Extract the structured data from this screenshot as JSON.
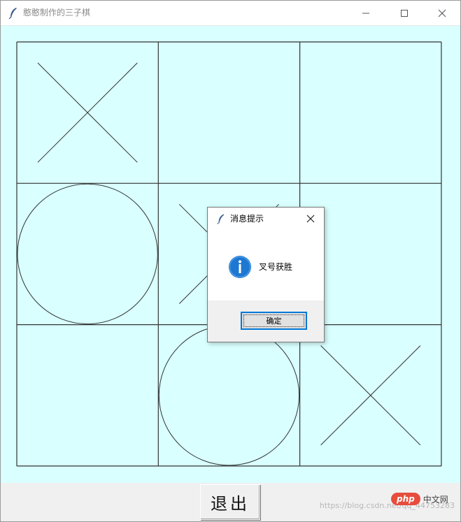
{
  "window": {
    "title": "憨憨制作的三子棋",
    "icon": "feather-icon",
    "controls": [
      "minimize-icon",
      "maximize-icon",
      "close-icon"
    ]
  },
  "board": {
    "background": "#d9ffff",
    "cells": [
      [
        "X",
        "",
        ""
      ],
      [
        "O",
        "X",
        ""
      ],
      [
        "",
        "O",
        "X"
      ]
    ]
  },
  "bottom": {
    "quit_label": "退出"
  },
  "dialog": {
    "title": "消息提示",
    "icon": "info-icon",
    "message": "叉号获胜",
    "ok_label": "确定"
  },
  "watermark": {
    "text": "https://blog.csdn.net/qq_44753283",
    "brand_pill": "php",
    "brand_text": "中文网"
  },
  "colors": {
    "accent": "#0078d7",
    "brand": "#e74c3c"
  }
}
